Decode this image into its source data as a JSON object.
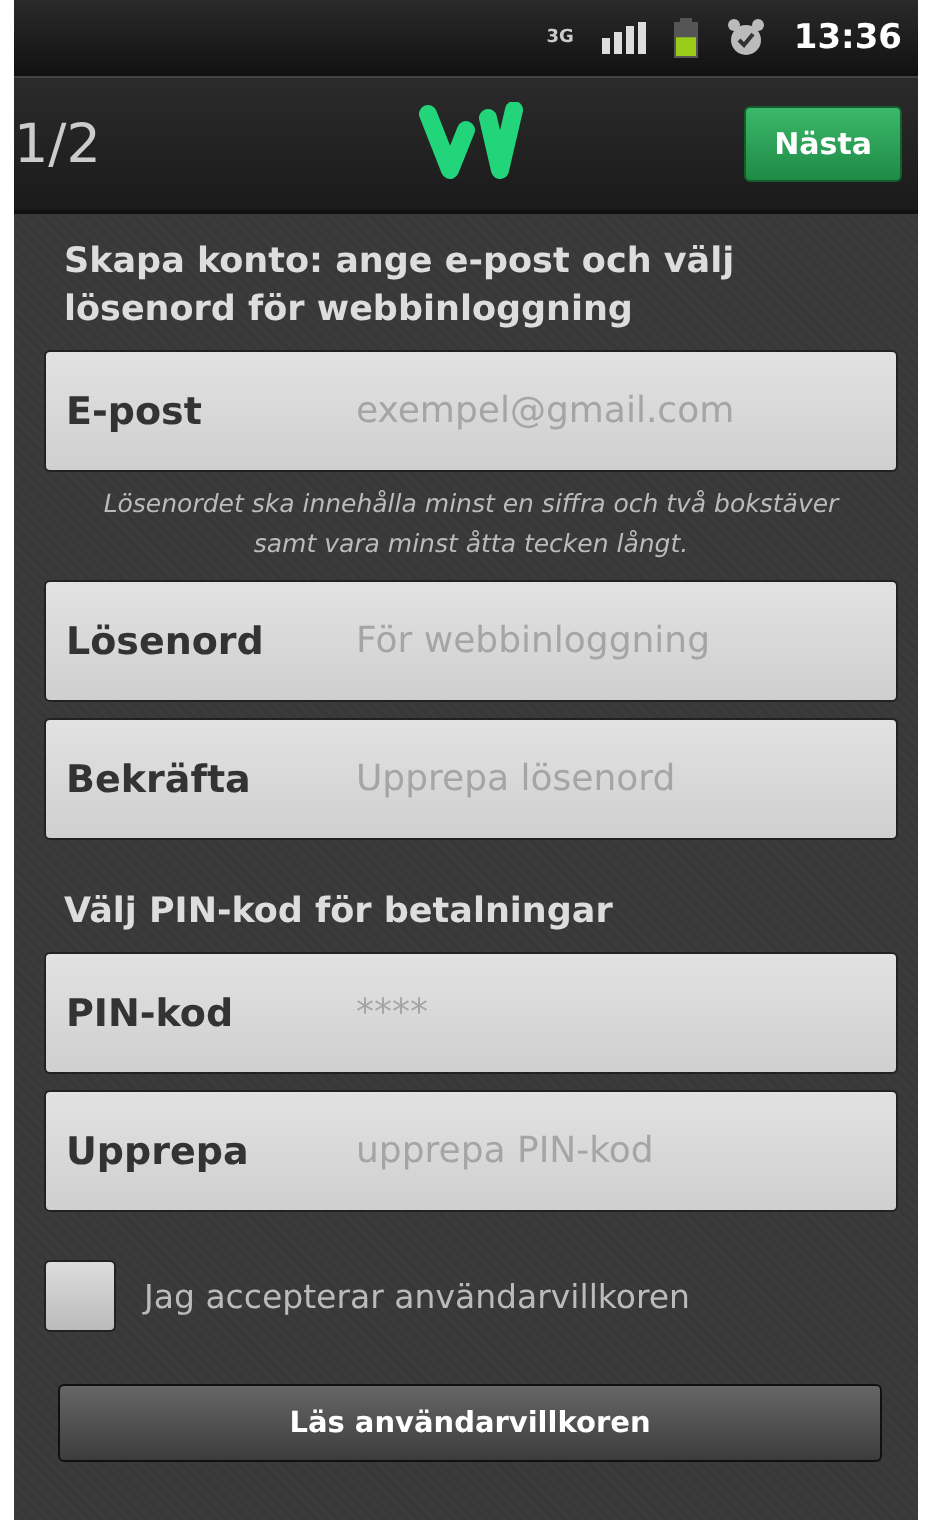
{
  "status_bar": {
    "network": "3G",
    "time": "13:36"
  },
  "header": {
    "step": "1/2",
    "next_button": "Nästa"
  },
  "account_section": {
    "heading": "Skapa konto: ange e-post och välj lösenord för webbinloggning",
    "fields": [
      {
        "kind": "field",
        "label": "E-post",
        "placeholder": "exempel@gmail.com"
      },
      {
        "kind": "hint",
        "text": "Lösenordet ska innehålla minst en siffra och två bokstäver samt vara minst åtta tecken långt."
      },
      {
        "kind": "field",
        "label": "Lösenord",
        "placeholder": "För webbinloggning"
      },
      {
        "kind": "field",
        "label": "Bekräfta",
        "placeholder": "Upprepa lösenord"
      }
    ]
  },
  "pin_section": {
    "heading": "Välj PIN-kod för betalningar",
    "fields": [
      {
        "kind": "field",
        "label": "PIN-kod",
        "placeholder": "****"
      },
      {
        "kind": "field",
        "label": "Upprepa",
        "placeholder": "upprepa PIN-kod"
      }
    ]
  },
  "terms": {
    "label": "Jag accepterar användarvillkoren",
    "checked": false
  },
  "read_terms_button": "Läs användarvillkoren"
}
